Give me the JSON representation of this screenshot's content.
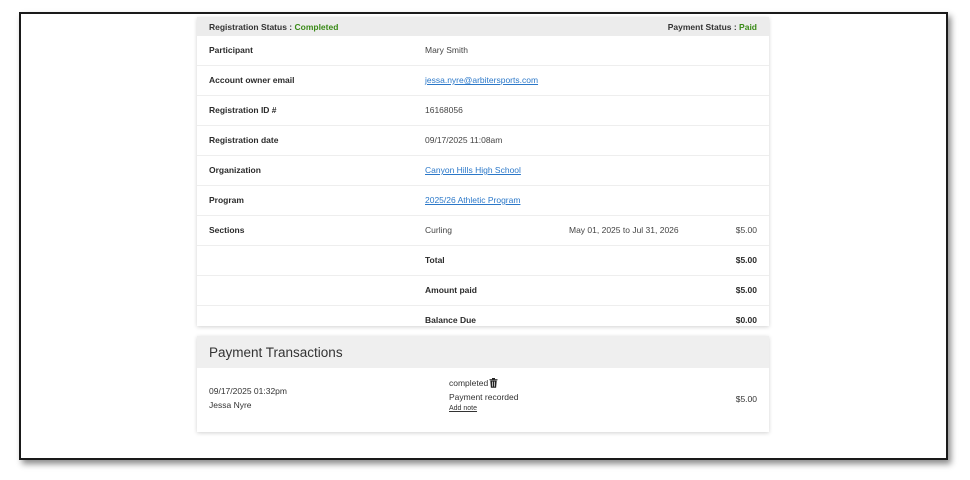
{
  "status_bar": {
    "registration_label": "Registration Status : ",
    "registration_value": "Completed",
    "payment_label": "Payment Status : ",
    "payment_value": "Paid"
  },
  "details": {
    "participant": {
      "label": "Participant",
      "value": "Mary Smith"
    },
    "email": {
      "label": "Account owner email",
      "value": "jessa.nyre@arbitersports.com"
    },
    "registration_id": {
      "label": "Registration ID #",
      "value": "16168056"
    },
    "registration_date": {
      "label": "Registration date",
      "value": "09/17/2025 11:08am"
    },
    "organization": {
      "label": "Organization",
      "value": "Canyon Hills High School"
    },
    "program": {
      "label": "Program",
      "value": "2025/26 Athletic Program"
    },
    "sections": {
      "label": "Sections",
      "name": "Curling",
      "dates": "May 01, 2025 to Jul 31, 2026",
      "amount": "$5.00"
    }
  },
  "totals": {
    "total": {
      "label": "Total",
      "amount": "$5.00"
    },
    "amount_paid": {
      "label": "Amount paid",
      "amount": "$5.00"
    },
    "balance_due": {
      "label": "Balance Due",
      "amount": "$0.00"
    }
  },
  "payments": {
    "title": "Payment Transactions",
    "transaction": {
      "date": "09/17/2025 01:32pm",
      "user": "Jessa Nyre",
      "status": "completed",
      "description": "Payment recorded",
      "add_note": "Add note",
      "amount": "$5.00"
    }
  },
  "colors": {
    "status_green": "#3a8a17",
    "link_blue": "#2b78c9"
  },
  "icons": {
    "delete": "trash-icon"
  }
}
